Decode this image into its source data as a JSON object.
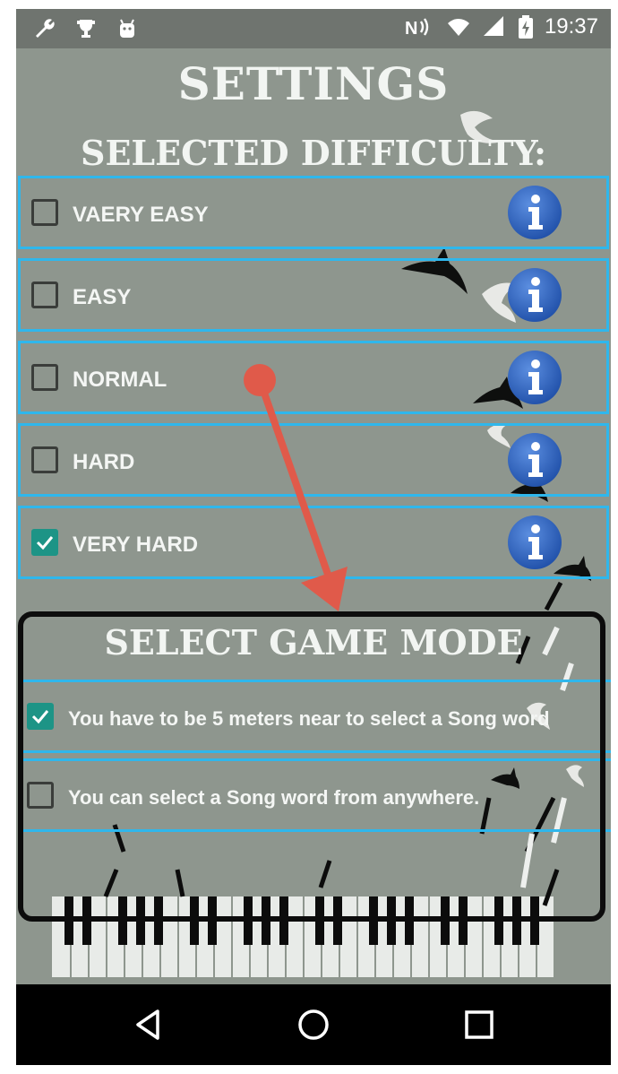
{
  "status_bar": {
    "time": "19:37",
    "left_icons": [
      "wrench-icon",
      "trophy-icon",
      "android-icon"
    ],
    "right_icons": [
      "nfc-icon",
      "wifi-icon",
      "signal-icon",
      "battery-icon"
    ]
  },
  "page": {
    "title": "SETTINGS",
    "difficulty_heading": "SELECTED DIFFICULTY:"
  },
  "difficulty": {
    "options": [
      {
        "label": "VAERY EASY",
        "checked": false
      },
      {
        "label": "EASY",
        "checked": false
      },
      {
        "label": "NORMAL",
        "checked": false
      },
      {
        "label": "HARD",
        "checked": false
      },
      {
        "label": "VERY HARD",
        "checked": true
      }
    ]
  },
  "game_mode": {
    "heading": "SELECT GAME MODE",
    "options": [
      {
        "label": "You have to be 5 meters near to select a Song word",
        "checked": true
      },
      {
        "label": "You can select a Song word from anywhere.",
        "checked": false
      }
    ]
  },
  "nav_bar": {
    "buttons": [
      "back-icon",
      "home-icon",
      "recents-icon"
    ]
  },
  "colors": {
    "background": "#8e968e",
    "row_border": "#2fb7ec",
    "checked": "#1d9486",
    "annotation_arrow": "#e05a4a",
    "annotation_box": "#0c0c0c"
  }
}
